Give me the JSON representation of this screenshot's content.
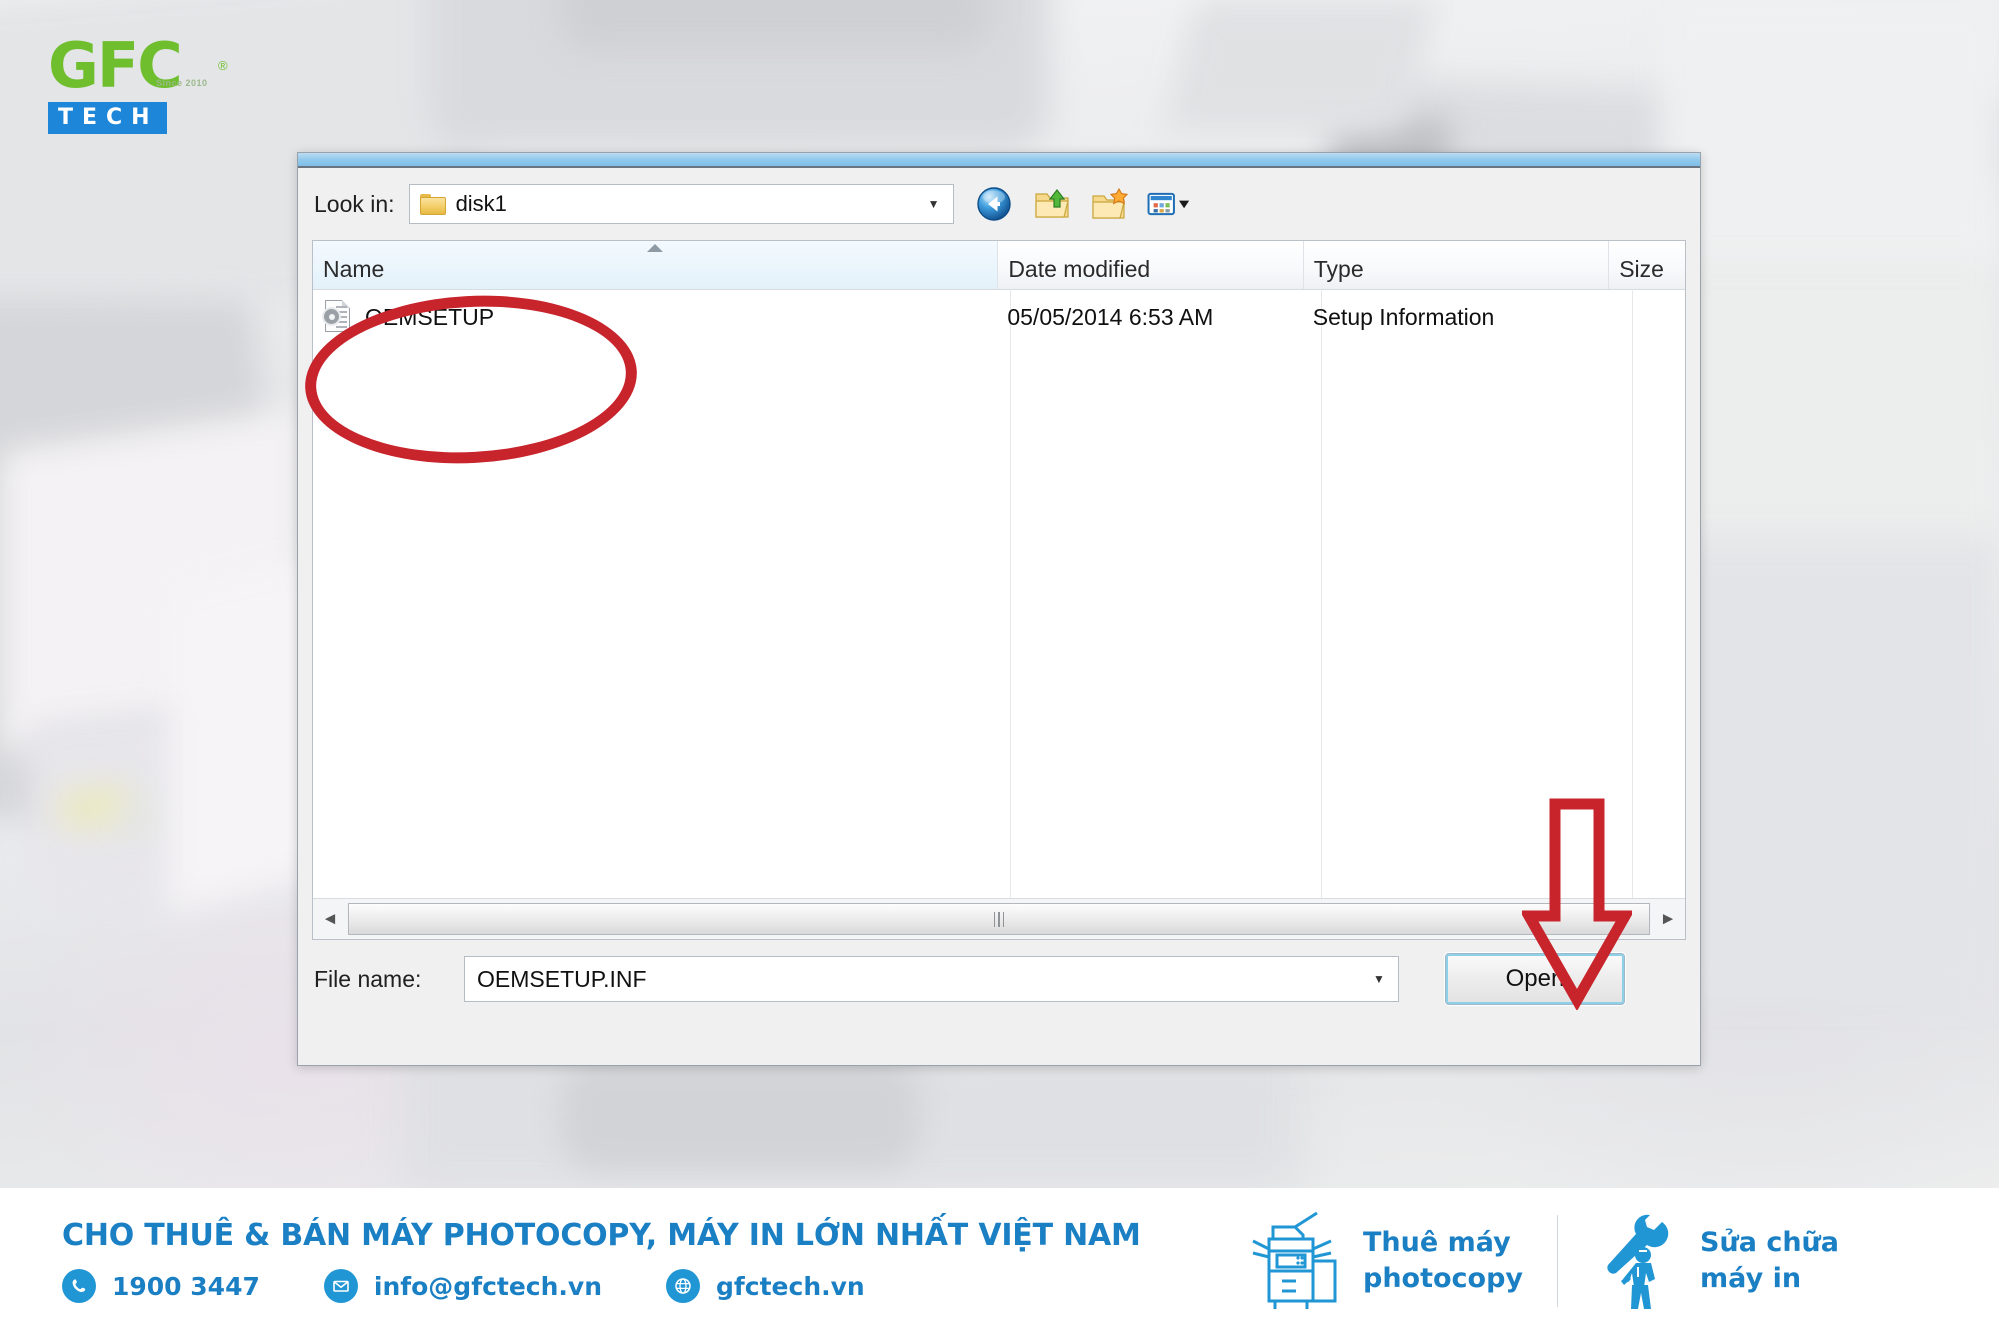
{
  "brand": {
    "logo_main": "GFC",
    "logo_since": "Since 2010",
    "logo_reg": "®",
    "logo_sub": "TECH"
  },
  "dialog": {
    "look_in_label": "Look in:",
    "look_in_value": "disk1",
    "toolbar": {
      "back": "back-icon",
      "up": "up-folder-icon",
      "new_folder": "new-folder-icon",
      "views": "views-icon"
    },
    "columns": [
      "Name",
      "Date modified",
      "Type",
      "Size"
    ],
    "sort_column": "Name",
    "sort_direction": "ascending",
    "files": [
      {
        "name": "OEMSETUP",
        "date_modified": "05/05/2014 6:53 AM",
        "type": "Setup Information",
        "size": ""
      }
    ],
    "file_name_label": "File name:",
    "file_name_value": "OEMSETUP.INF",
    "open_button": "Open",
    "accent_focus": "#8fd0e8"
  },
  "annotations": {
    "ellipse_target": "OEMSETUP",
    "arrow_target": "Open",
    "color": "#c8242c"
  },
  "footer": {
    "headline": "CHO THUÊ & BÁN MÁY PHOTOCOPY, MÁY IN LỚN NHẤT VIỆT NAM",
    "contacts": [
      {
        "icon": "phone-icon",
        "text": "1900 3447"
      },
      {
        "icon": "email-icon",
        "text": "info@gfctech.vn"
      },
      {
        "icon": "globe-icon",
        "text": "gfctech.vn"
      }
    ],
    "services": [
      {
        "icon": "copier-icon",
        "line1": "Thuê máy",
        "line2": "photocopy"
      },
      {
        "icon": "repair-technician-icon",
        "line1": "Sửa chữa",
        "line2": "máy in"
      }
    ],
    "brand_color": "#1b7fc4"
  }
}
